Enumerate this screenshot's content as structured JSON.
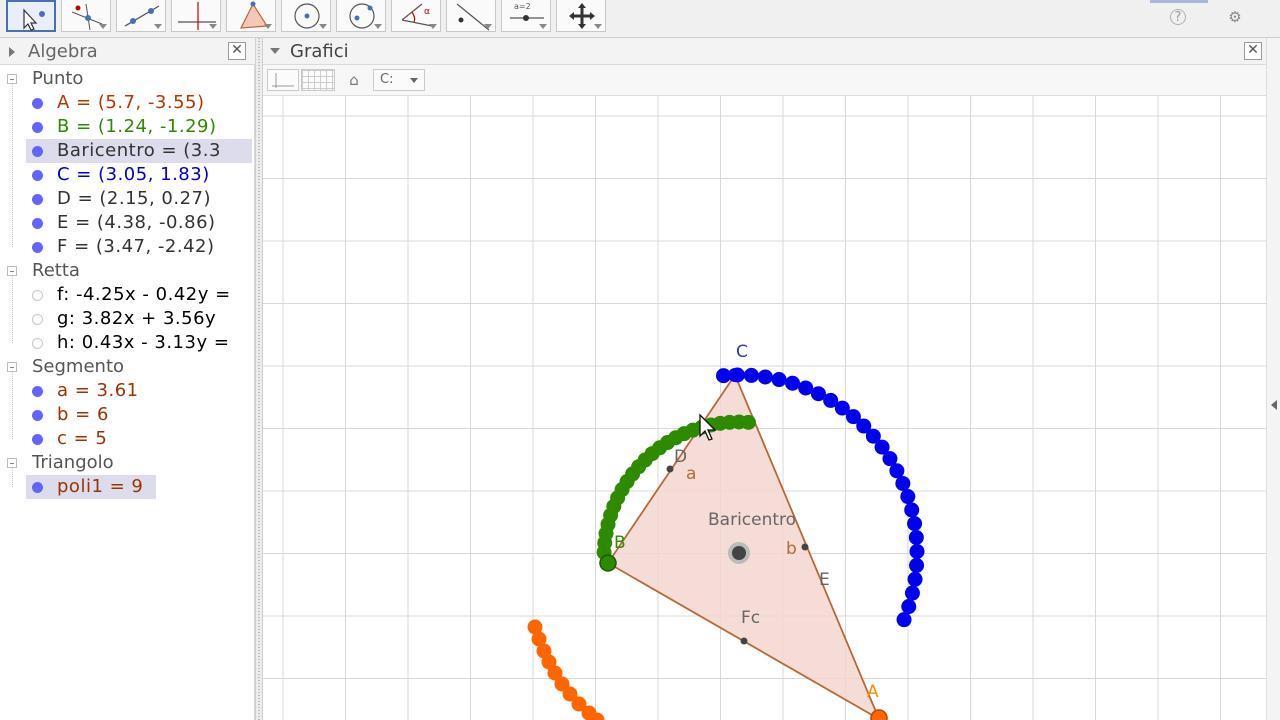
{
  "toolbar": {
    "tools": [
      {
        "name": "move-tool",
        "label": ""
      },
      {
        "name": "point-tool",
        "label": ""
      },
      {
        "name": "line-tool",
        "label": ""
      },
      {
        "name": "perpendicular-tool",
        "label": ""
      },
      {
        "name": "polygon-tool",
        "label": ""
      },
      {
        "name": "circle-tool",
        "label": ""
      },
      {
        "name": "circle-through-points-tool",
        "label": ""
      },
      {
        "name": "angle-tool",
        "label": ""
      },
      {
        "name": "reflect-tool",
        "label": ""
      },
      {
        "name": "slider-tool",
        "label": "a=2"
      },
      {
        "name": "move-view-tool",
        "label": ""
      }
    ],
    "help_icon": "?",
    "settings_icon": "⚙"
  },
  "algebra": {
    "title": "Algebra",
    "close": "✕",
    "categories": [
      {
        "label": "Punto",
        "items": [
          {
            "text": "A = (5.7, -3.55)",
            "color": "#b23800",
            "bullet": "filled",
            "selected": false
          },
          {
            "text": "B = (1.24, -1.29)",
            "color": "#2e8a00",
            "bullet": "filled",
            "selected": false
          },
          {
            "text": "Baricentro = (3.3",
            "color": "#333333",
            "bullet": "filled",
            "selected": true
          },
          {
            "text": "C = (3.05, 1.83)",
            "color": "#0000cc",
            "bullet": "filled",
            "selected": false
          },
          {
            "text": "D = (2.15, 0.27)",
            "color": "#333333",
            "bullet": "filled",
            "selected": false
          },
          {
            "text": "E = (4.38, -0.86)",
            "color": "#333333",
            "bullet": "filled",
            "selected": false
          },
          {
            "text": "F = (3.47, -2.42)",
            "color": "#333333",
            "bullet": "filled",
            "selected": false
          }
        ]
      },
      {
        "label": "Retta",
        "items": [
          {
            "text": "f: -4.25x - 0.42y =",
            "color": "#000000",
            "bullet": "hollow",
            "selected": false
          },
          {
            "text": "g: 3.82x + 3.56y",
            "color": "#000000",
            "bullet": "hollow",
            "selected": false
          },
          {
            "text": "h: 0.43x - 3.13y =",
            "color": "#000000",
            "bullet": "hollow",
            "selected": false
          }
        ]
      },
      {
        "label": "Segmento",
        "items": [
          {
            "text": "a = 3.61",
            "color": "#993300",
            "bullet": "filled",
            "selected": false
          },
          {
            "text": "b = 6",
            "color": "#993300",
            "bullet": "filled",
            "selected": false
          },
          {
            "text": "c = 5",
            "color": "#993300",
            "bullet": "filled",
            "selected": false
          }
        ]
      },
      {
        "label": "Triangolo",
        "items": [
          {
            "text": "poli1 = 9",
            "color": "#993300",
            "bullet": "filled",
            "selected": true
          }
        ]
      }
    ]
  },
  "graphics": {
    "title": "Grafici",
    "close": "✕",
    "view_button": "C:",
    "home_icon": "⌂",
    "labels": {
      "C": "C",
      "D": "D",
      "a": "a",
      "B": "B",
      "baricentro": "Baricentro",
      "b": "b",
      "E": "E",
      "Fc": "Fc",
      "A": "A"
    },
    "colors": {
      "grid": "#d8d8d8",
      "triangle_fill": "#f4d6cf",
      "triangle_edge": "#b56a3b",
      "trace_green": "#2e8b00",
      "trace_blue": "#0000ee",
      "trace_orange": "#ff6600",
      "point_label": "#666666",
      "C_label": "#3333cc",
      "A_label": "#ff8c00"
    }
  }
}
